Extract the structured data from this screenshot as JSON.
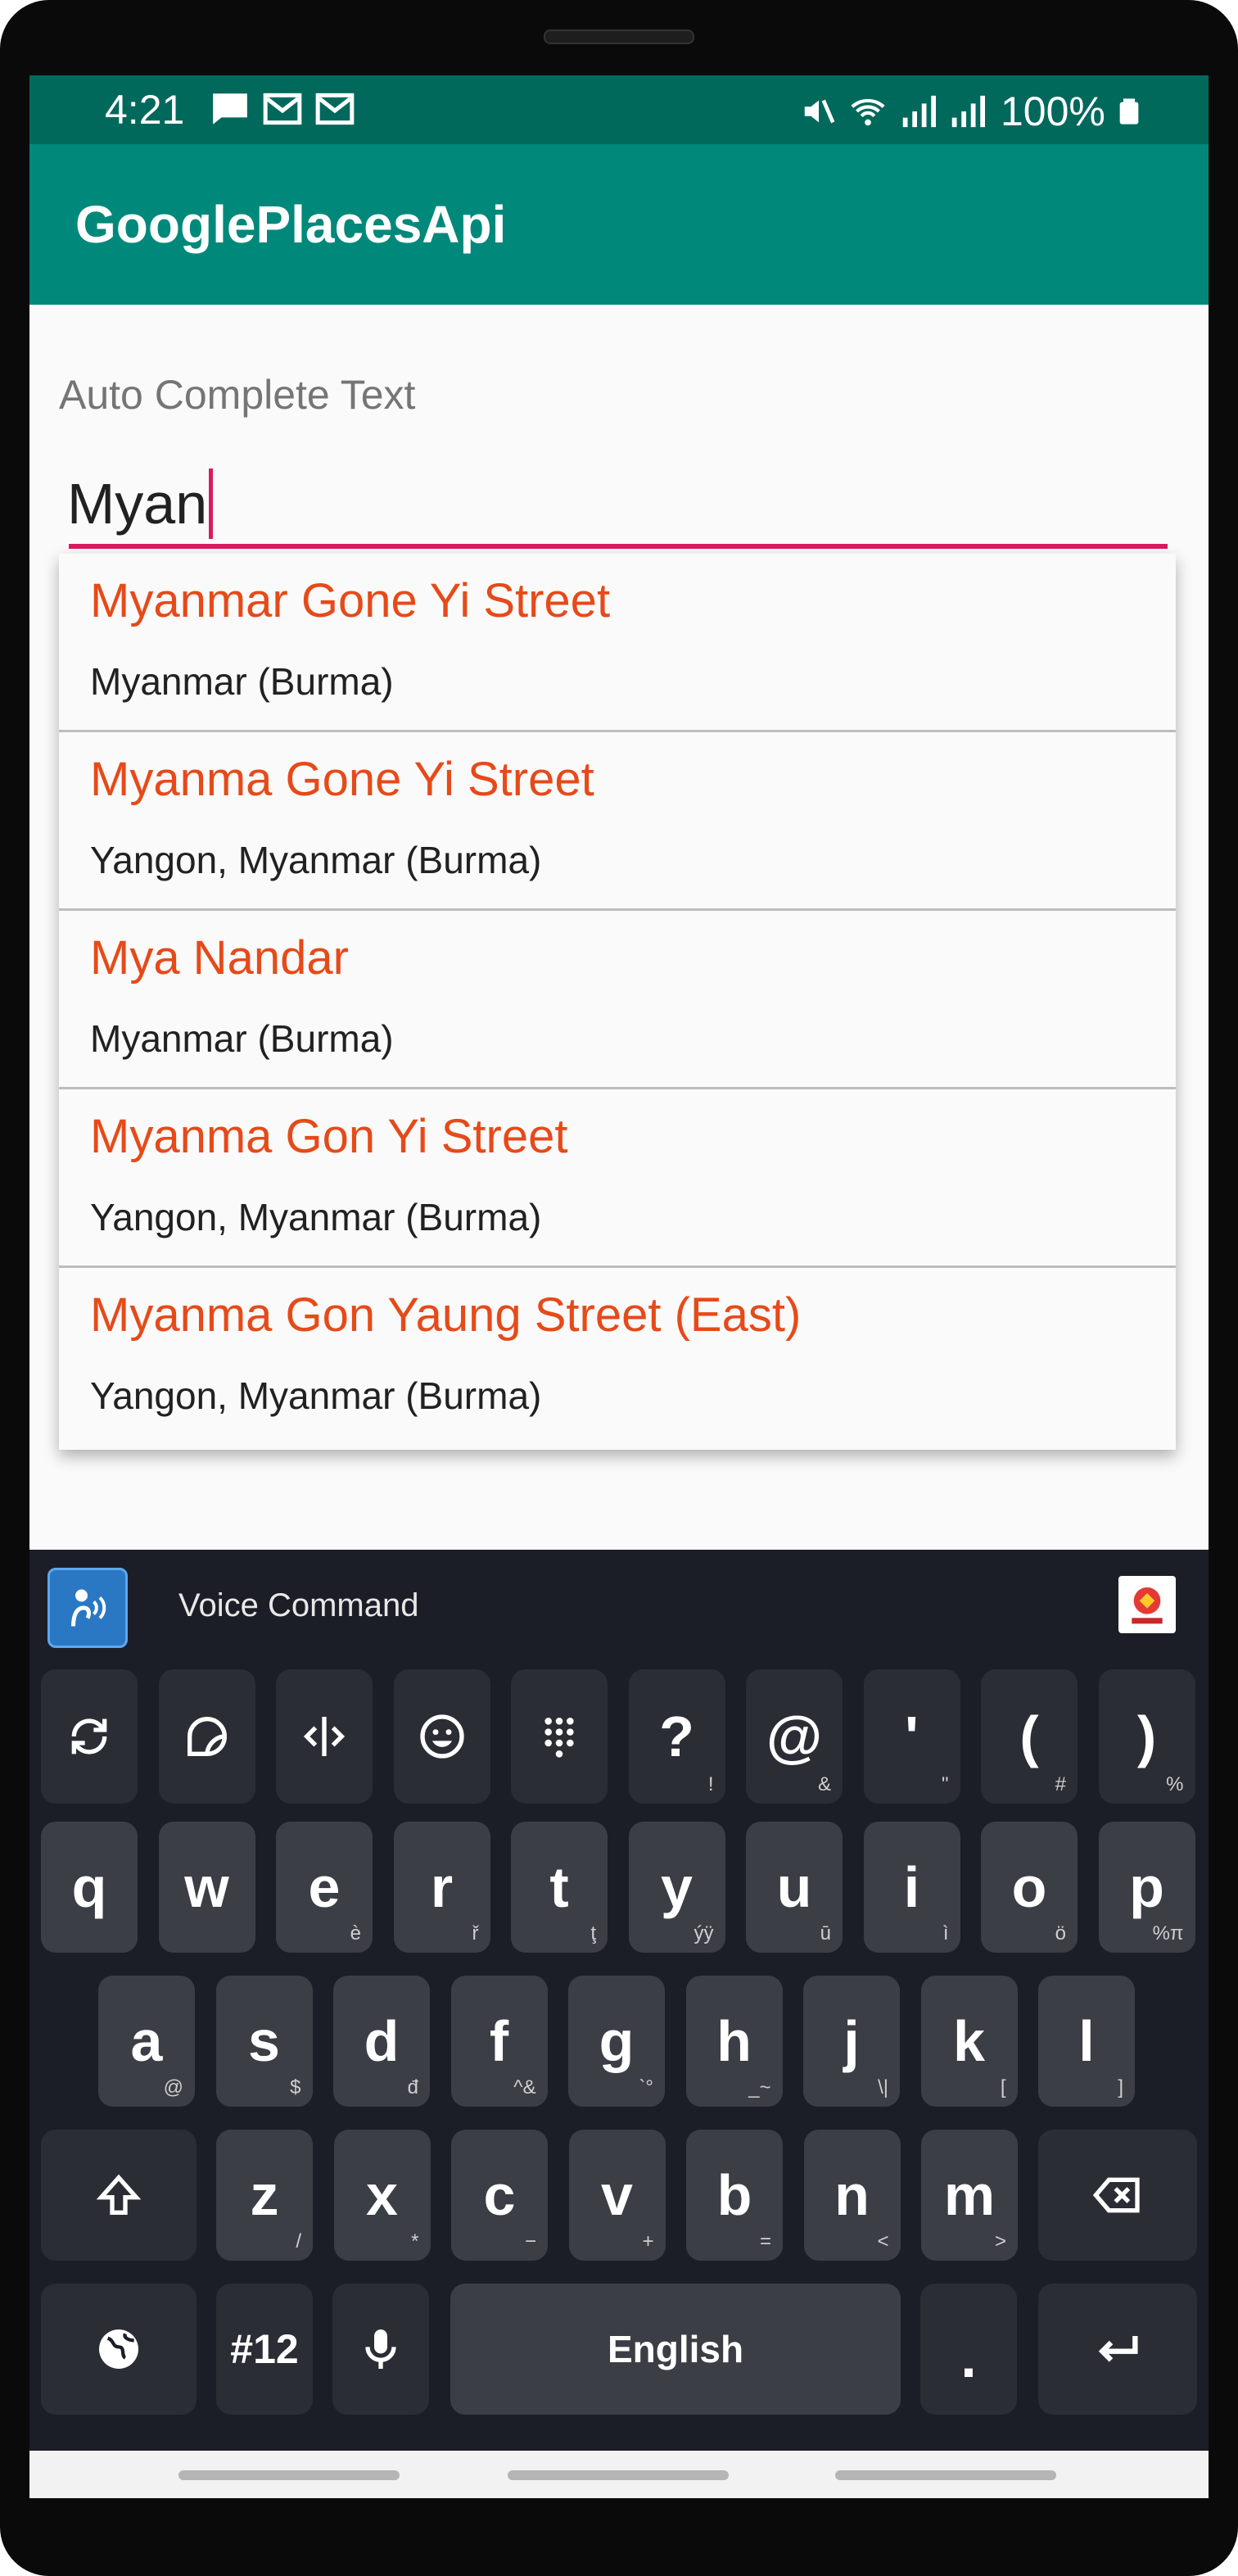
{
  "status_bar": {
    "time": "4:21",
    "battery": "100%",
    "left_icons": [
      "message-icon",
      "mail-icon",
      "mail-icon"
    ],
    "right_icons": [
      "mute-icon",
      "wifi-icon",
      "signal-icon",
      "signal-roaming-icon",
      "battery-icon"
    ]
  },
  "app_bar": {
    "title": "GooglePlacesApi"
  },
  "form": {
    "label": "Auto Complete Text",
    "input_value": "Myan"
  },
  "suggestions": [
    {
      "primary": "Myanmar Gone Yi Street",
      "secondary": "Myanmar (Burma)"
    },
    {
      "primary": "Myanma Gone Yi Street",
      "secondary": "Yangon, Myanmar (Burma)"
    },
    {
      "primary": "Mya Nandar",
      "secondary": "Myanmar (Burma)"
    },
    {
      "primary": "Myanma Gon Yi Street",
      "secondary": "Yangon, Myanmar (Burma)"
    },
    {
      "primary": "Myanma Gon Yaung Street (East)",
      "secondary": "Yangon, Myanmar (Burma)"
    }
  ],
  "keyboard": {
    "toolbar_label": "Voice Command",
    "symbol_row": [
      {
        "icon": "rotate-icon"
      },
      {
        "icon": "sticker-icon"
      },
      {
        "icon": "cursor-icon"
      },
      {
        "icon": "emoji-icon"
      },
      {
        "icon": "numpad-icon"
      },
      {
        "label": "?",
        "hint": "!"
      },
      {
        "label": "@",
        "hint": "&"
      },
      {
        "label": "'",
        "hint": "\""
      },
      {
        "label": "(",
        "hint": "#"
      },
      {
        "label": ")",
        "hint": "%"
      }
    ],
    "row1": [
      {
        "label": "q",
        "hint": ""
      },
      {
        "label": "w",
        "hint": ""
      },
      {
        "label": "e",
        "hint": "è"
      },
      {
        "label": "r",
        "hint": "ř"
      },
      {
        "label": "t",
        "hint": "ţ"
      },
      {
        "label": "y",
        "hint": "ýÿ"
      },
      {
        "label": "u",
        "hint": "ū"
      },
      {
        "label": "i",
        "hint": "ì"
      },
      {
        "label": "o",
        "hint": "ö"
      },
      {
        "label": "p",
        "hint": "%π"
      }
    ],
    "row2": [
      {
        "label": "a",
        "hint": "@"
      },
      {
        "label": "s",
        "hint": "$"
      },
      {
        "label": "d",
        "hint": "đ"
      },
      {
        "label": "f",
        "hint": "^&"
      },
      {
        "label": "g",
        "hint": "`°"
      },
      {
        "label": "h",
        "hint": "_~"
      },
      {
        "label": "j",
        "hint": "\\|"
      },
      {
        "label": "k",
        "hint": "["
      },
      {
        "label": "l",
        "hint": "]"
      }
    ],
    "row3": [
      {
        "label": "z",
        "hint": "/"
      },
      {
        "label": "x",
        "hint": "*"
      },
      {
        "label": "c",
        "hint": "−"
      },
      {
        "label": "v",
        "hint": "+"
      },
      {
        "label": "b",
        "hint": "="
      },
      {
        "label": "n",
        "hint": "<"
      },
      {
        "label": "m",
        "hint": ">"
      }
    ],
    "numbers_label": "#12",
    "space_label": "English",
    "period_label": "."
  }
}
